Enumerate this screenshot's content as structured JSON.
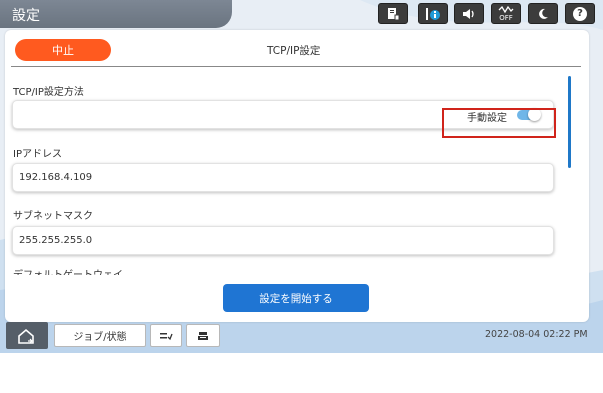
{
  "header": {
    "title": "設定",
    "status_icons": [
      "printer-status-icon",
      "info-icon",
      "volume-icon",
      "wifi-off-icon",
      "sleep-moon-icon",
      "help-icon"
    ],
    "wifi_off_text": "OFF",
    "help_text": "?"
  },
  "panel": {
    "stop_label": "中止",
    "screen_title": "TCP/IP設定",
    "method_label": "TCP/IP設定方法",
    "method_toggle_label": "手動設定",
    "method_toggle_on": true,
    "ip_label": "IPアドレス",
    "ip_value": "192.168.4.109",
    "subnet_label": "サブネットマスク",
    "subnet_value": "255.255.255.0",
    "gateway_label": "デフォルトゲートウェイ",
    "start_label": "設定を開始する"
  },
  "bottom": {
    "job_status_label": "ジョブ/状態",
    "datetime": "2022-08-04 02:22 PM"
  },
  "colors": {
    "stop_button": "#ff5a1f",
    "start_button": "#1f75d3",
    "highlight": "#d0241b",
    "toggle_on": "#6fb6e8"
  }
}
